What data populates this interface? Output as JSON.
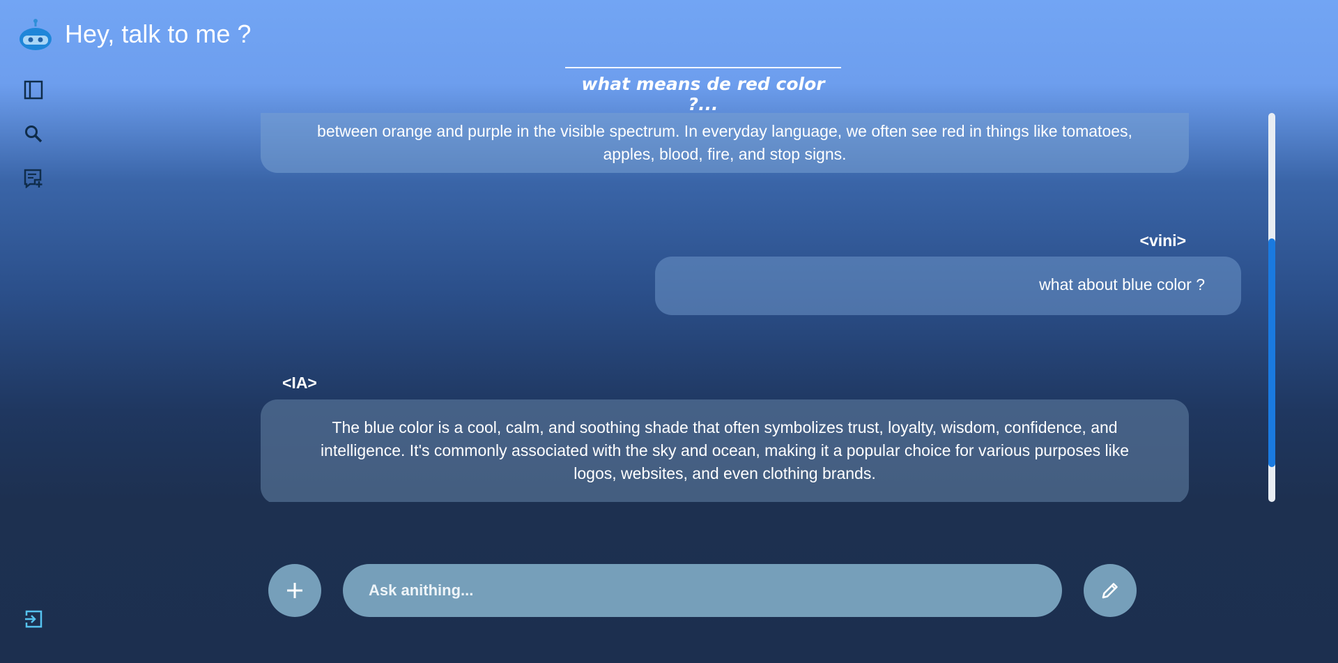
{
  "app": {
    "title": "Hey, talk to me ?",
    "logo_icon": "robot-icon"
  },
  "sidebar": {
    "items": [
      {
        "name": "sidebar-toggle-icon"
      },
      {
        "name": "search-icon"
      },
      {
        "name": "new-chat-icon"
      }
    ],
    "logout_icon": "logout-icon"
  },
  "conversation": {
    "title": "what means de red color ?...",
    "messages": [
      {
        "sender": "",
        "text": "between orange and purple in the visible spectrum. In everyday language, we often see red in things like tomatoes, apples, blood, fire, and stop signs."
      },
      {
        "sender": "<vini>",
        "text": "what about blue color ?"
      },
      {
        "sender": "<IA>",
        "text": "The blue color is a cool, calm, and soothing shade that often symbolizes trust, loyalty, wisdom, confidence, and intelligence. It's commonly associated with the sky and ocean, making it a popular choice for various purposes like logos, websites, and even clothing brands."
      }
    ]
  },
  "composer": {
    "placeholder": "Ask anithing...",
    "add_icon": "plus-icon",
    "send_icon": "pencil-icon"
  },
  "colors": {
    "accent": "#1a7ae0",
    "input_bg": "#769fba"
  }
}
